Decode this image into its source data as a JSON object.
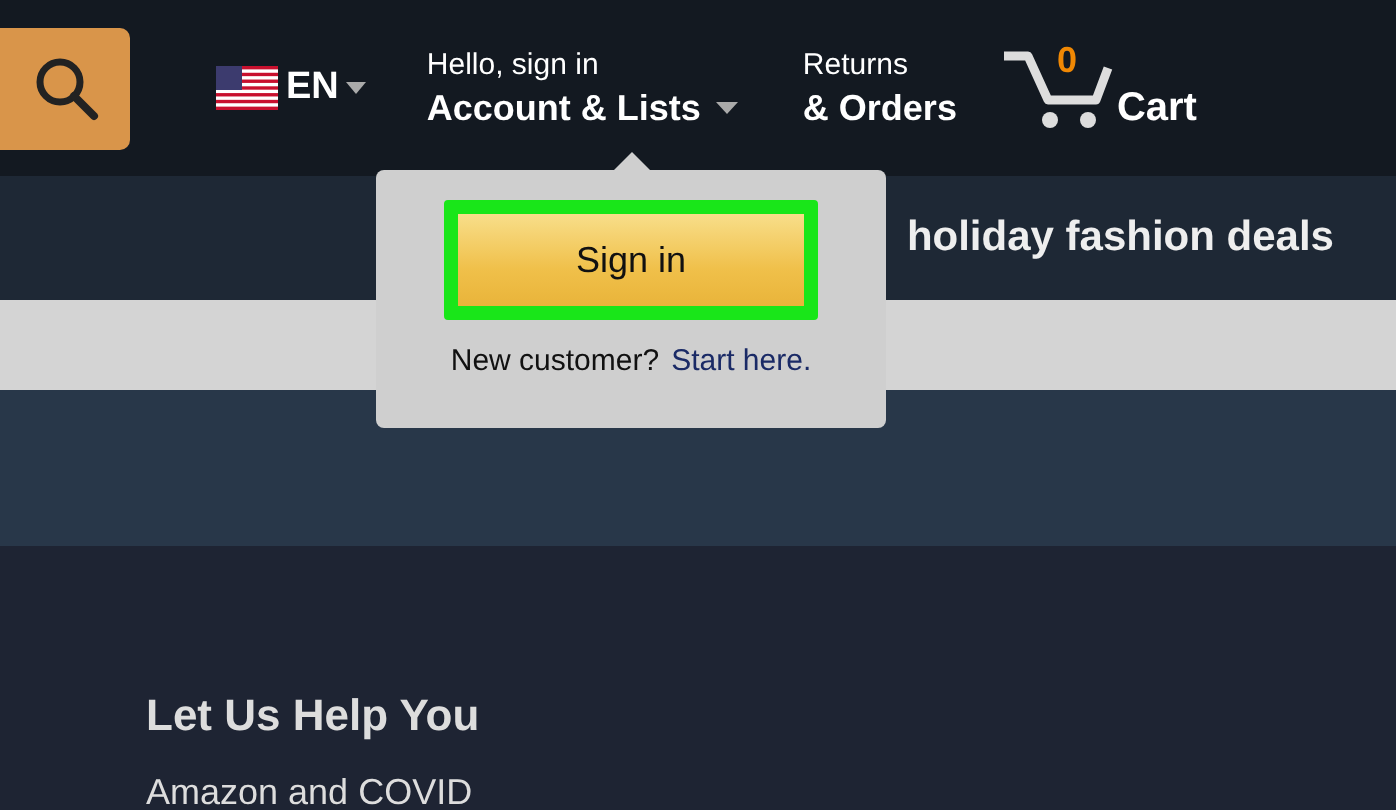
{
  "header": {
    "language": "EN",
    "account": {
      "greeting": "Hello, sign in",
      "label": "Account & Lists"
    },
    "returns": {
      "line1": "Returns",
      "line2": "& Orders"
    },
    "cart": {
      "count": "0",
      "label": "Cart"
    }
  },
  "promo": "holiday fashion deals",
  "account_popup": {
    "sign_in_button": "Sign in",
    "highlighted": true,
    "prompt": "New customer?",
    "link": "Start here."
  },
  "footer": {
    "heading": "Let Us Help You",
    "links": [
      "Amazon and COVID"
    ]
  }
}
